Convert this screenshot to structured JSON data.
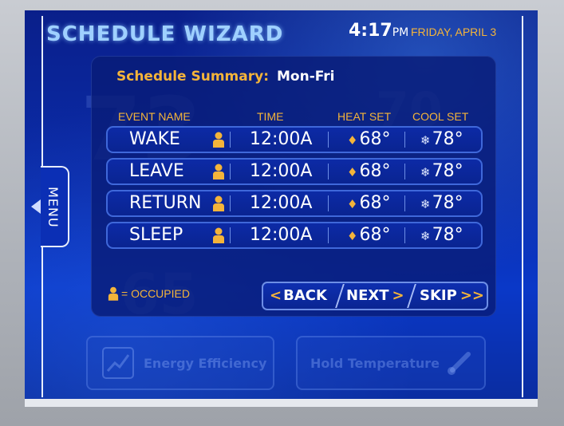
{
  "header": {
    "title": "SCHEDULE WIZARD",
    "time": "4:17",
    "ampm": "PM",
    "date": "FRIDAY, APRIL 3"
  },
  "menu_tab": {
    "label": "MENU"
  },
  "summary": {
    "label": "Schedule Summary:",
    "value": "Mon-Fri"
  },
  "columns": [
    "EVENT NAME",
    "TIME",
    "HEAT SET",
    "COOL SET"
  ],
  "events": [
    {
      "name": "WAKE",
      "time": "12:00A",
      "heat": "68°",
      "cool": "78°"
    },
    {
      "name": "LEAVE",
      "time": "12:00A",
      "heat": "68°",
      "cool": "78°"
    },
    {
      "name": "RETURN",
      "time": "12:00A",
      "heat": "68°",
      "cool": "78°"
    },
    {
      "name": "SLEEP",
      "time": "12:00A",
      "heat": "68°",
      "cool": "78°"
    }
  ],
  "legend": {
    "text": "= OCCUPIED"
  },
  "nav": {
    "back_arrow": "<",
    "back_label": "BACK",
    "next_label": "NEXT",
    "next_arrow": ">",
    "skip_label": "SKIP",
    "skip_arrow": ">>"
  },
  "background": {
    "energy_label": "Energy Efficiency",
    "hold_label": "Hold Temperature"
  },
  "colors": {
    "accent": "#f4b43a",
    "screen_blue": "#0b2dac",
    "row_border": "#3f68da"
  },
  "icons": [
    "person-icon",
    "flame-icon",
    "snowflake-icon",
    "menu-arrow-icon",
    "chart-icon",
    "thermometer-icon"
  ]
}
